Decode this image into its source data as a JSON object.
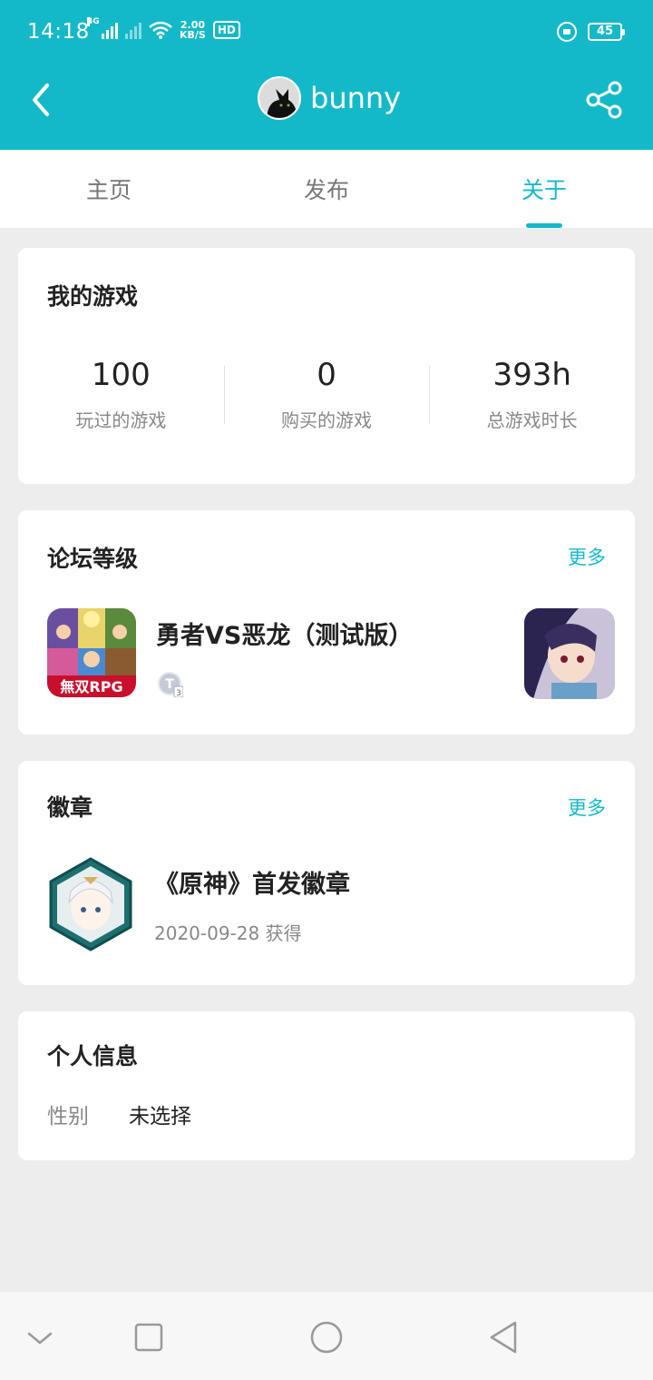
{
  "status": {
    "time": "14:18",
    "net_label": "4G",
    "net_speed_value": "2.00",
    "net_speed_unit": "KB/S",
    "hd_label": "HD",
    "battery": "45"
  },
  "header": {
    "username": "bunny"
  },
  "tabs": [
    {
      "label": "主页"
    },
    {
      "label": "发布"
    },
    {
      "label": "关于"
    }
  ],
  "games_card": {
    "title": "我的游戏",
    "stats": [
      {
        "value": "100",
        "label": "玩过的游戏"
      },
      {
        "value": "0",
        "label": "购买的游戏"
      },
      {
        "value": "393h",
        "label": "总游戏时长"
      }
    ]
  },
  "forum_card": {
    "title": "论坛等级",
    "more": "更多",
    "game_name": "勇者VS恶龙（测试版）",
    "icon_text": "無双RPG",
    "level_letter": "T",
    "level_number": "3"
  },
  "badge_card": {
    "title": "徽章",
    "more": "更多",
    "badge_name": "《原神》首发徽章",
    "badge_date": "2020-09-28 获得"
  },
  "info_card": {
    "title": "个人信息",
    "gender_label": "性别",
    "gender_value": "未选择"
  },
  "colors": {
    "accent": "#14b9c9",
    "background": "#ededed"
  }
}
